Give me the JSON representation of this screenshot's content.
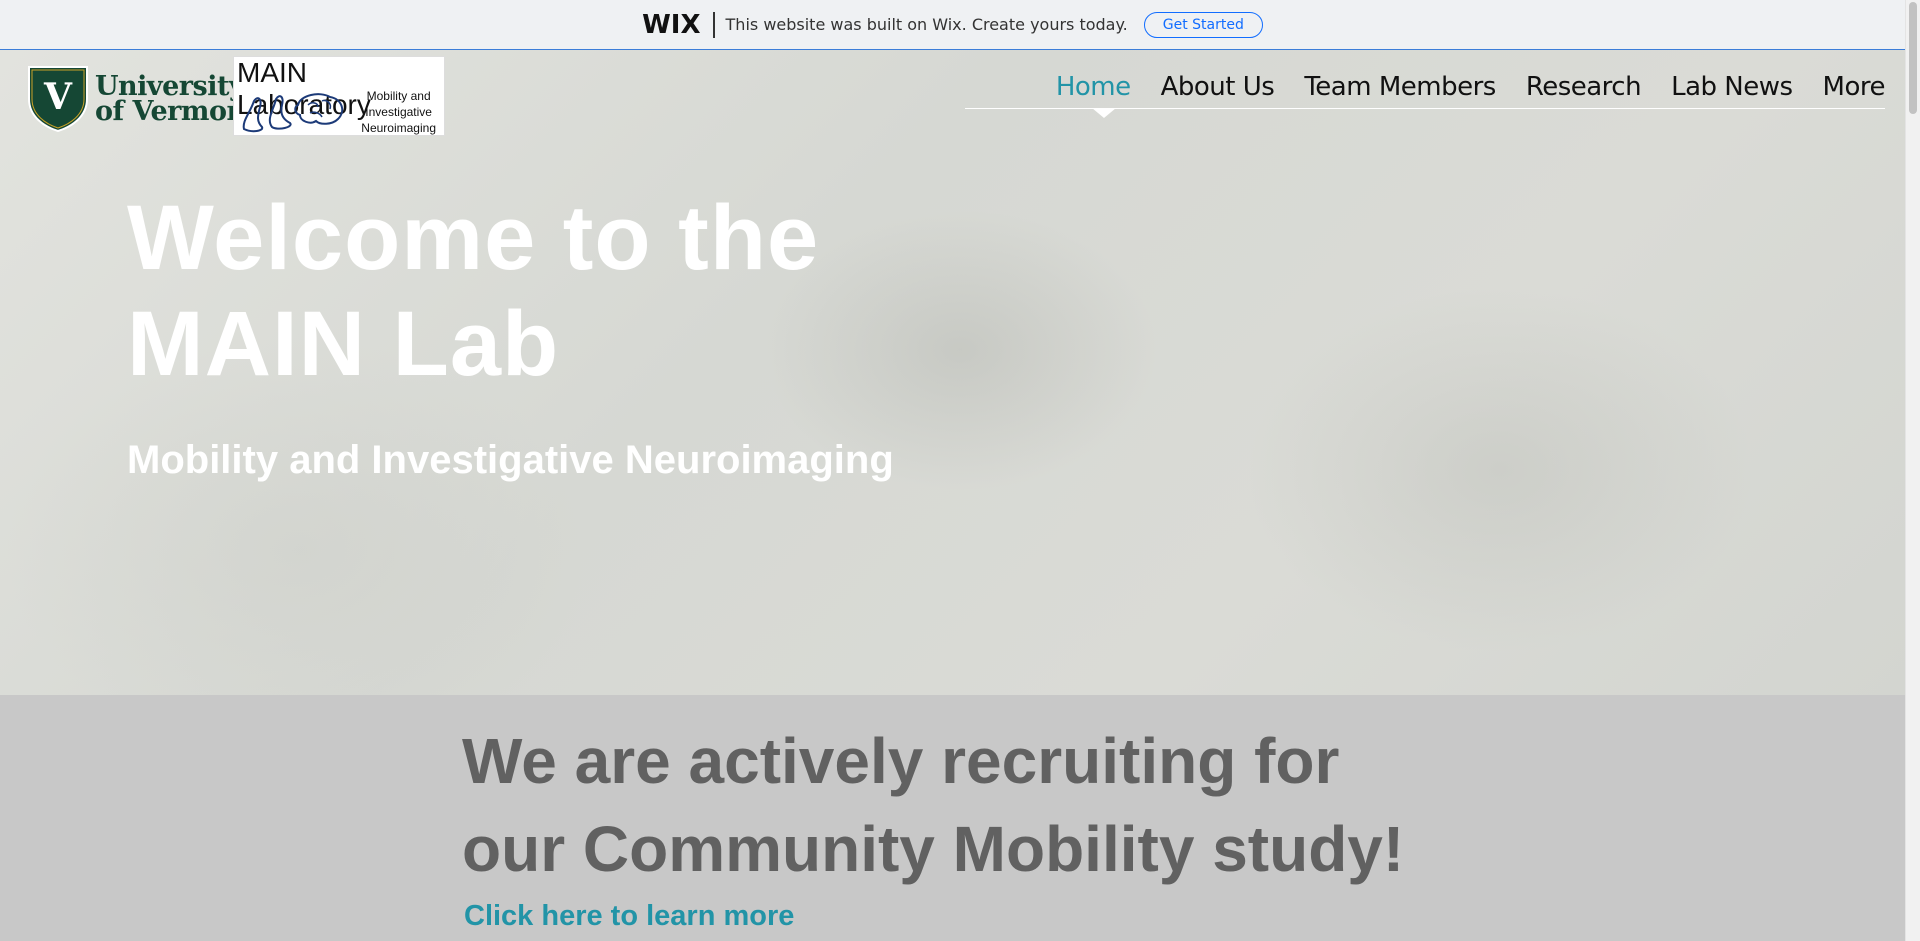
{
  "wix_banner": {
    "logo": "WIX",
    "message": "This website was built on Wix. Create yours today.",
    "cta": "Get Started"
  },
  "header": {
    "uvm_logo": {
      "line1": "University",
      "line2": "of Vermont",
      "shield_letter": "V"
    },
    "lab_logo": {
      "title": "MAIN Laboratory",
      "subtitle_lines": [
        "Mobility and",
        "Investigative",
        "Neuroimaging"
      ]
    },
    "nav": {
      "items": [
        {
          "label": "Home",
          "active": true
        },
        {
          "label": "About Us"
        },
        {
          "label": "Team Members"
        },
        {
          "label": "Research"
        },
        {
          "label": "Lab News"
        },
        {
          "label": "More"
        }
      ]
    }
  },
  "hero": {
    "title_line1": "Welcome to the",
    "title_line2": "MAIN Lab",
    "subtitle": "Mobility and Investigative Neuroimaging"
  },
  "recruit": {
    "heading_line1": "We are actively recruiting for",
    "heading_line2": "our Community Mobility study!",
    "link": "Click here to learn more"
  },
  "colors": {
    "accent": "#2294a7",
    "uvm_green": "#154734",
    "wix_blue": "#116dff",
    "heading_gray": "#616161"
  }
}
